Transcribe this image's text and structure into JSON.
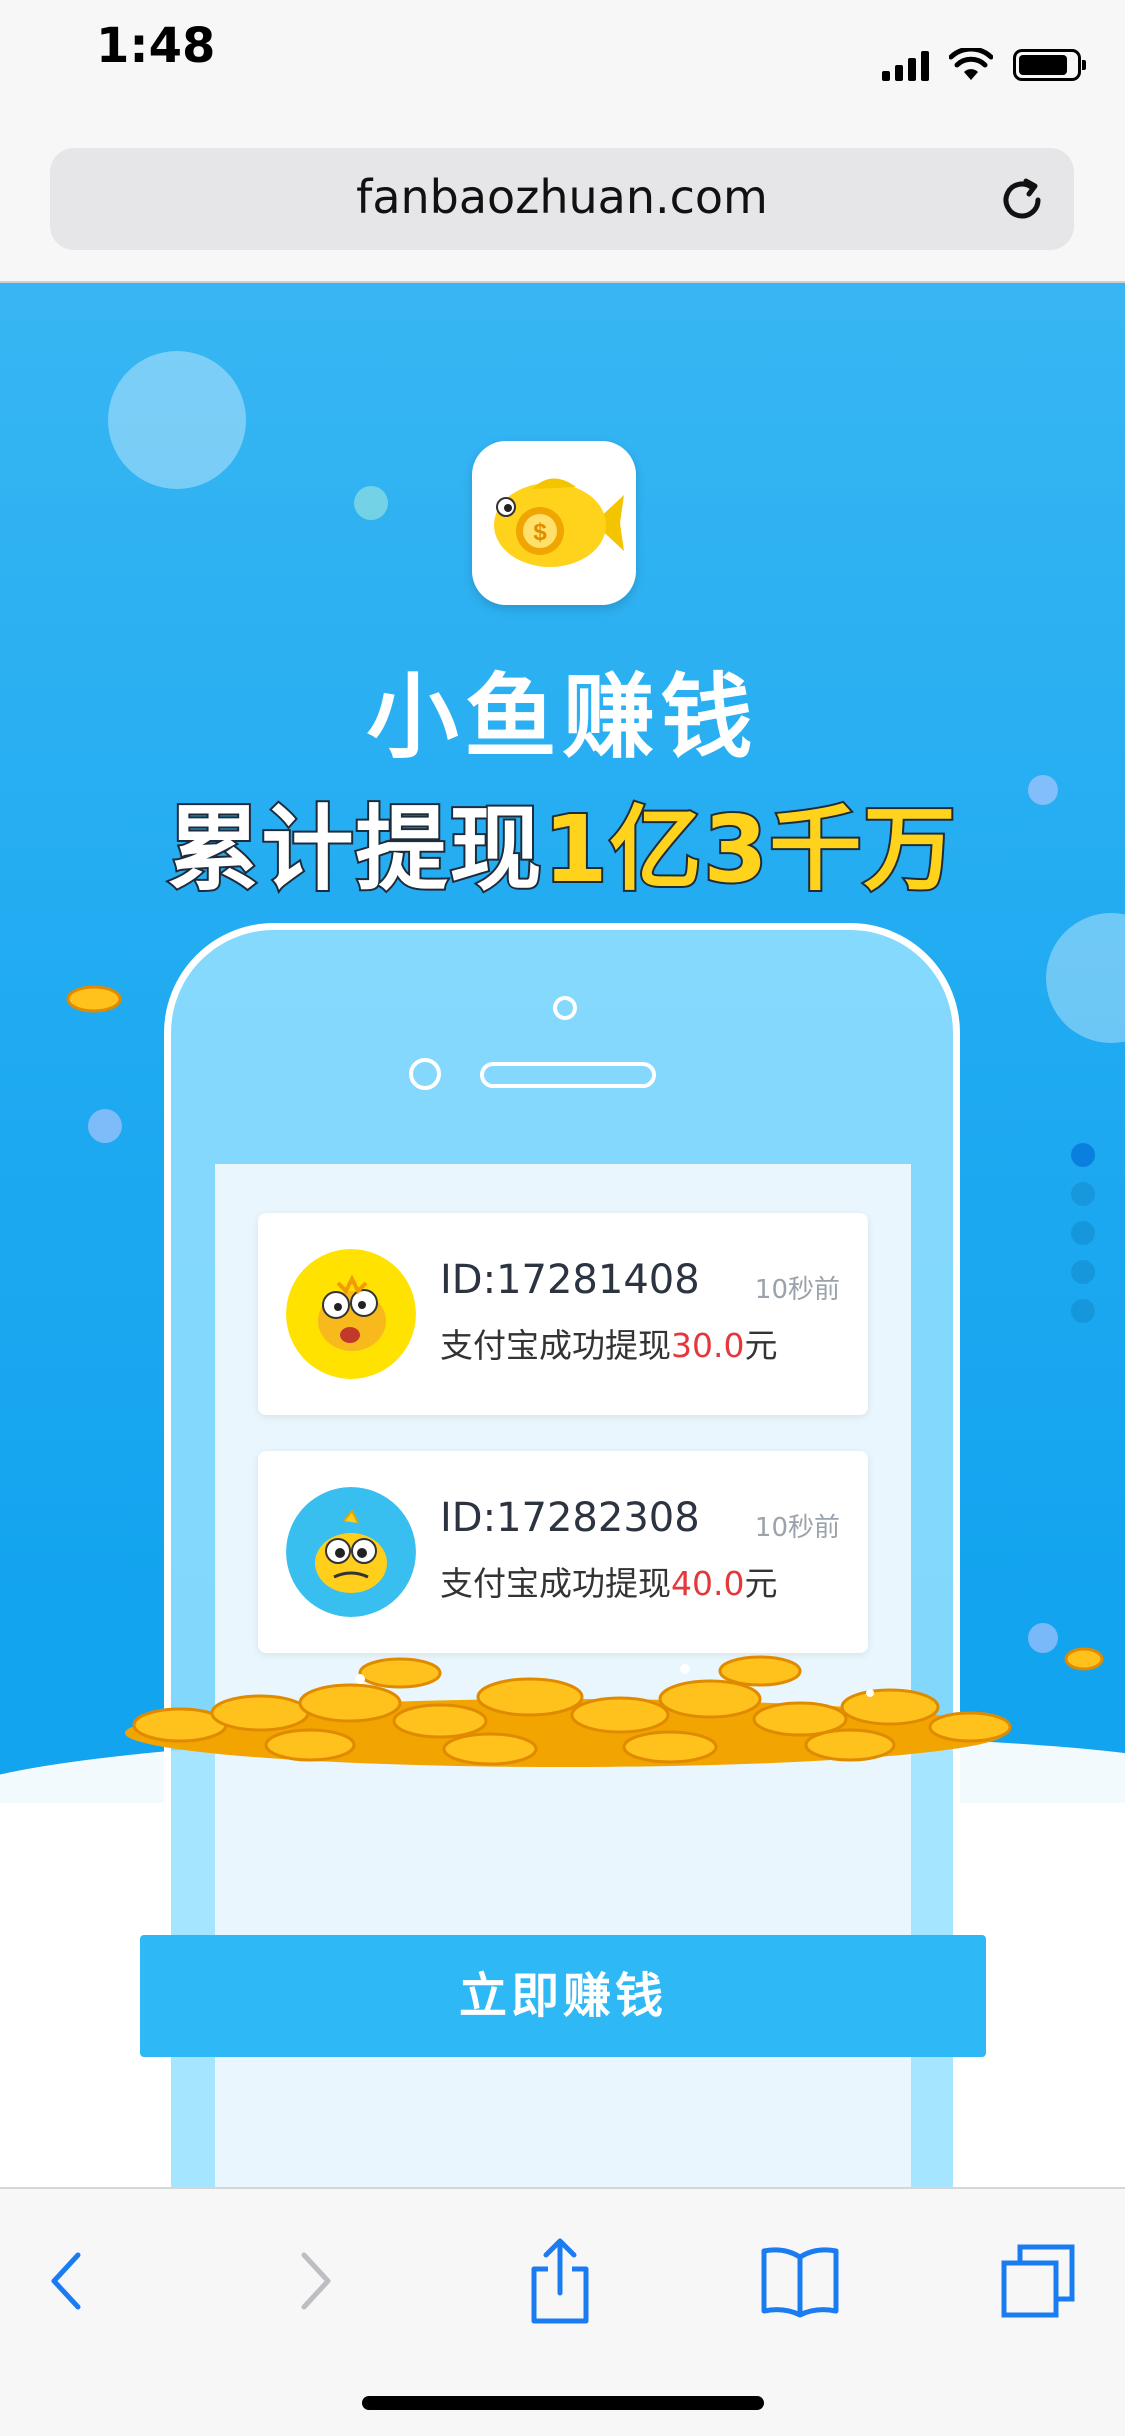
{
  "status_bar": {
    "time": "1:48",
    "battery_level": 0.86
  },
  "browser": {
    "url": "fanbaozhuan.com"
  },
  "hero": {
    "app_name": "小鱼赚钱",
    "headline_white": "累计提现",
    "headline_gold": "1亿3千万"
  },
  "feed": [
    {
      "id": "ID:17281408",
      "time": "10秒前",
      "msg_prefix": "支付宝成功提现",
      "amount": "30.0",
      "unit": "元"
    },
    {
      "id": "ID:17282308",
      "time": "10秒前",
      "msg_prefix": "支付宝成功提现",
      "amount": "40.0",
      "unit": "元"
    }
  ],
  "carousel": {
    "pages": 5,
    "active": 1
  },
  "cta": {
    "label": "立即赚钱"
  },
  "toolbar": {
    "icons": [
      "back-icon",
      "forward-icon",
      "share-icon",
      "bookmarks-icon",
      "tabs-icon"
    ]
  },
  "colors": {
    "accent": "#1faaf1",
    "amount": "#e4393c",
    "gold": "#ffd21c",
    "cta": "#2fb8f6"
  }
}
